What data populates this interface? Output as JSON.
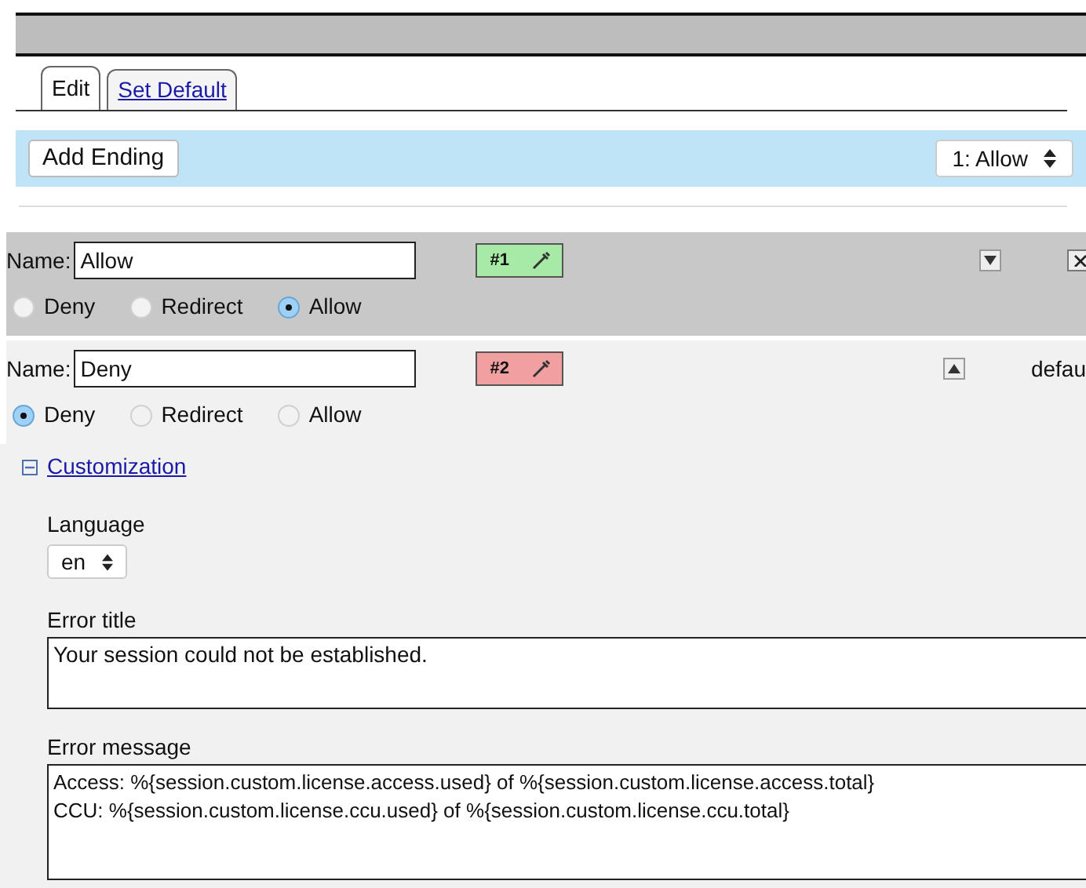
{
  "tabs": [
    {
      "label": "Edit",
      "selected": true
    },
    {
      "label": "Set Default",
      "selected": false
    }
  ],
  "toolbar": {
    "add_button": "Add Ending",
    "ending_select": "1: Allow"
  },
  "endings": [
    {
      "name_label": "Name:",
      "name": "Allow",
      "number": "#1",
      "color": "#a6eaa6",
      "selected": true,
      "points_up": false,
      "closable": true,
      "options": [
        {
          "label": "Deny",
          "selected": false
        },
        {
          "label": "Redirect",
          "selected": false
        },
        {
          "label": "Allow",
          "selected": true
        }
      ]
    },
    {
      "name_label": "Name:",
      "name": "Deny",
      "number": "#2",
      "color": "#f0a0a0",
      "selected": false,
      "points_up": true,
      "closable": false,
      "trailing_text": "defau",
      "options": [
        {
          "label": "Deny",
          "selected": true
        },
        {
          "label": "Redirect",
          "selected": false
        },
        {
          "label": "Allow",
          "selected": false
        }
      ]
    }
  ],
  "customization": {
    "label": "Customization",
    "expanded": true,
    "language_label": "Language",
    "language": "en",
    "error_title_label": "Error title",
    "error_title": "Your session could not be established.",
    "error_message_label": "Error message",
    "error_message": [
      "Access: %{session.custom.license.access.used} of %{session.custom.license.access.total}",
      "CCU: %{session.custom.license.ccu.used} of %{session.custom.license.ccu.total}"
    ]
  }
}
